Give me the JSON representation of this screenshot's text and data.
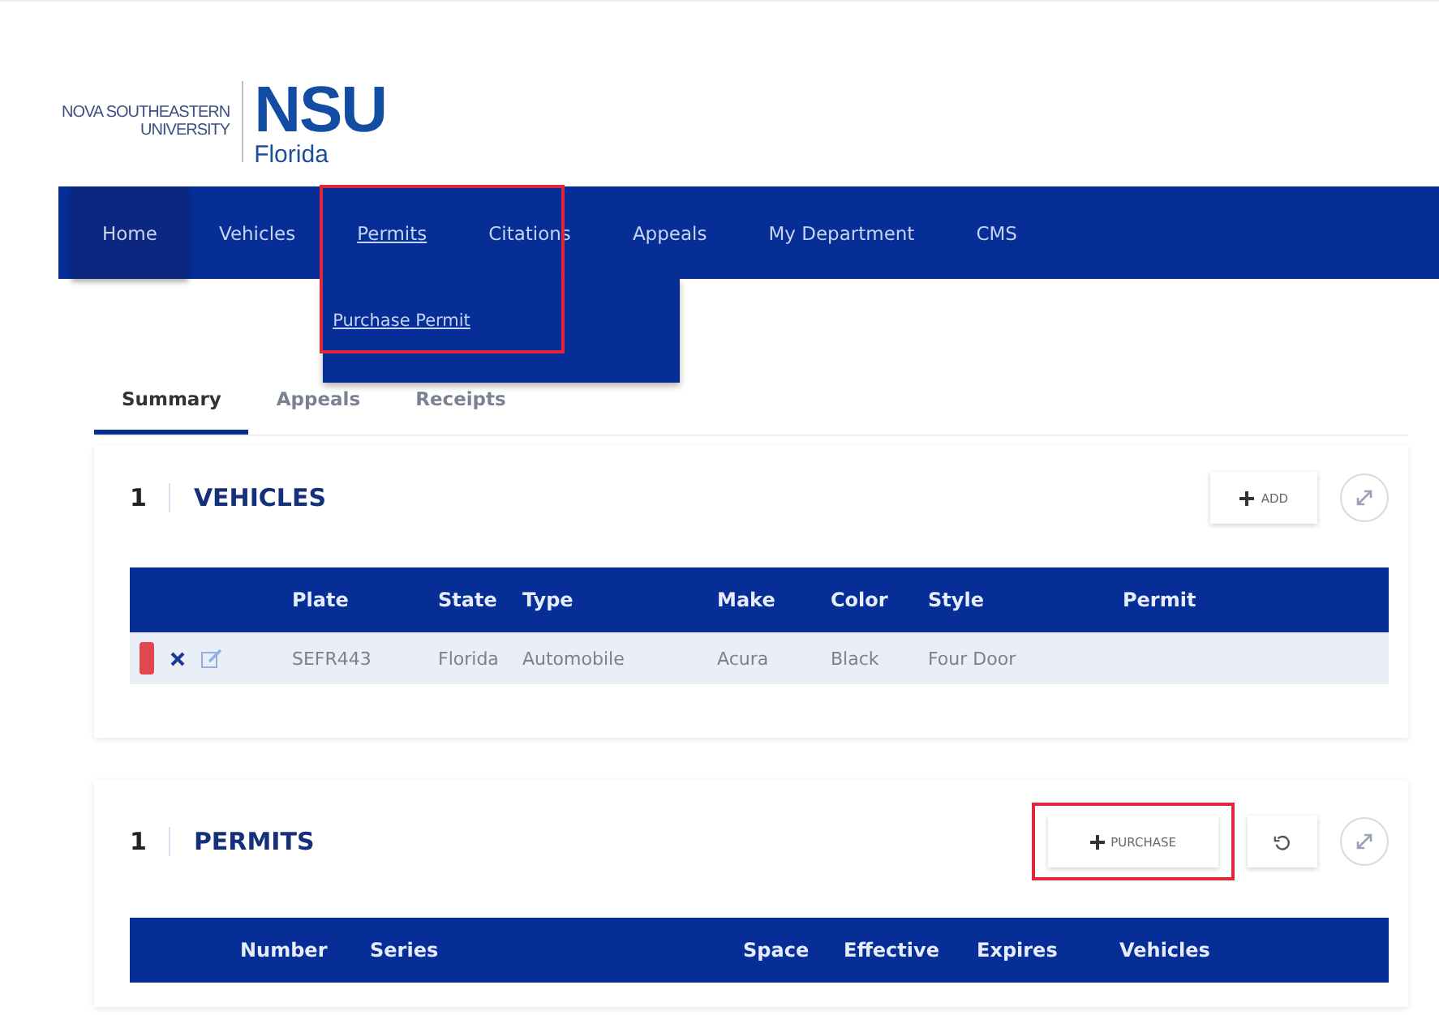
{
  "logo": {
    "line1": "NOVA SOUTHEASTERN",
    "line2": "UNIVERSITY",
    "abbr": "NSU",
    "state": "Florida"
  },
  "nav": [
    {
      "label": "Home",
      "selected": true,
      "highlighted": false
    },
    {
      "label": "Vehicles",
      "selected": false,
      "highlighted": false
    },
    {
      "label": "Permits",
      "selected": false,
      "highlighted": true,
      "menu": [
        "Purchase Permit"
      ]
    },
    {
      "label": "Citations",
      "selected": false,
      "highlighted": false
    },
    {
      "label": "Appeals",
      "selected": false,
      "highlighted": false
    },
    {
      "label": "My Department",
      "selected": false,
      "highlighted": false
    },
    {
      "label": "CMS",
      "selected": false,
      "highlighted": false
    }
  ],
  "tabs": [
    {
      "label": "Summary",
      "selected": true
    },
    {
      "label": "Appeals",
      "selected": false
    },
    {
      "label": "Receipts",
      "selected": false
    }
  ],
  "vehicles": {
    "count": "1",
    "title": "VEHICLES",
    "action": "ADD",
    "columns": [
      "",
      "Plate",
      "State",
      "Type",
      "Make",
      "Color",
      "Style",
      "Permit"
    ],
    "rows": [
      {
        "color": "#e0484f",
        "cells": [
          "",
          "SEFR443",
          "Florida",
          "Automobile",
          "Acura",
          "Black",
          "Four Door",
          ""
        ]
      }
    ]
  },
  "permits": {
    "count": "1",
    "title": "PERMITS",
    "action": "PURCHASE",
    "action_highlighted": true,
    "columns": [
      "",
      "Number",
      "Series",
      "",
      "Space",
      "Effective",
      "Expires",
      "Vehicles"
    ]
  }
}
